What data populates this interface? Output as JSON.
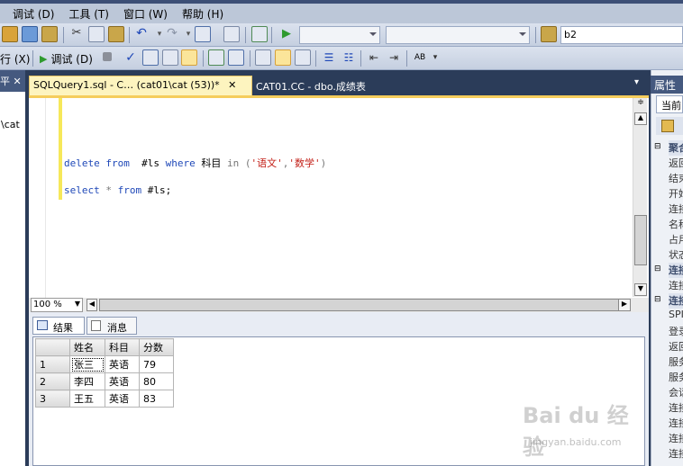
{
  "menu": [
    "调试 (D)",
    "工具 (T)",
    "窗口 (W)",
    "帮助 (H)"
  ],
  "toolbar1": {
    "server_combo": "b2"
  },
  "toolbar2": {
    "execute_label": "行 (X)",
    "debug_label": "调试 (D)",
    "spell_label": "AB"
  },
  "left_panel": {
    "close_glyph": "平 ✕",
    "tree_fragment": "\\cat"
  },
  "tabs": {
    "active": "SQLQuery1.sql - C… (cat01\\cat (53))*",
    "active_close": "✕",
    "second": "CAT01.CC - dbo.成绩表"
  },
  "editor": {
    "line1": {
      "kw1": "delete",
      "kw2": "from",
      "ident": "#ls",
      "kw3": "where",
      "col": "科目",
      "kw4": "in",
      "open": "(",
      "s1": "'语文'",
      "comma": ",",
      "s2": "'数学'",
      "close": ")"
    },
    "line2": {
      "kw1": "select",
      "star": "*",
      "kw2": "from",
      "ident": "#ls;"
    },
    "zoom": "100 %"
  },
  "results": {
    "tab_results": "结果",
    "tab_messages": "消息",
    "columns": [
      "姓名",
      "科目",
      "分数"
    ],
    "rows": [
      {
        "n": "1",
        "name": "张三",
        "subject": "英语",
        "score": "79"
      },
      {
        "n": "2",
        "name": "李四",
        "subject": "英语",
        "score": "80"
      },
      {
        "n": "3",
        "name": "王五",
        "subject": "英语",
        "score": "83"
      }
    ]
  },
  "properties": {
    "title": "属性",
    "current": "当前",
    "rows": [
      "聚合",
      "返回",
      "结束",
      "开始",
      "连接",
      "名称",
      "占用",
      "状态",
      "连接",
      "连接",
      "连接",
      "SPI",
      "登录",
      "返回",
      "服务",
      "服务",
      "会话",
      "连接",
      "连接",
      "连接",
      "连接"
    ]
  },
  "watermark": {
    "main": "Bai du 经验",
    "sub": "jingyan.baidu.com"
  }
}
